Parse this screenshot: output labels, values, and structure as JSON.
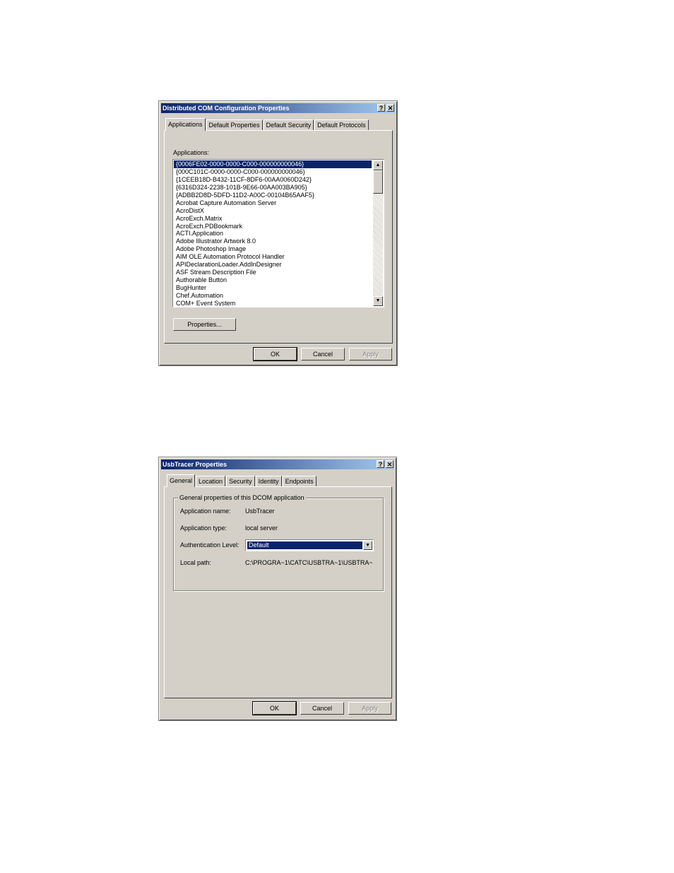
{
  "dialog1": {
    "title": "Distributed COM Configuration Properties",
    "help_btn": "?",
    "close_btn": "✕",
    "tabs": [
      "Applications",
      "Default Properties",
      "Default Security",
      "Default Protocols"
    ],
    "applications_label": "Applications:",
    "applications": [
      "{0006FE02-0000-0000-C000-000000000046}",
      "{000C101C-0000-0000-C000-000000000046}",
      "{1CEEB18D-B432-11CF-8DF6-00AA0060D242}",
      "{6316D324-2238-101B-9E66-00AA003BA905}",
      "{ADBB2D8D-5DFD-11D2-A00C-00104B65AAF5}",
      "Acrobat Capture Automation Server",
      "AcroDistX",
      "AcroExch.Matrix",
      "AcroExch.PDBookmark",
      "ACTI.Application",
      "Adobe Illustrator Artwork 8.0",
      "Adobe Photoshop Image",
      "AIM OLE Automation Protocol Handler",
      "APIDeclarationLoader.AddInDesigner",
      "ASF Stream Description File",
      "Authorable Button",
      "BugHunter",
      "Chef.Automation",
      "COM+ Event System"
    ],
    "selected_index": 0,
    "scroll_up": "▲",
    "scroll_down": "▼",
    "properties_btn": "Properties...",
    "ok_btn": "OK",
    "cancel_btn": "Cancel",
    "apply_btn": "Apply"
  },
  "dialog2": {
    "title": "UsbTracer Properties",
    "help_btn": "?",
    "close_btn": "✕",
    "tabs": [
      "General",
      "Location",
      "Security",
      "Identity",
      "Endpoints"
    ],
    "group_label": "General properties of this DCOM application",
    "app_name_label": "Application name:",
    "app_name_value": "UsbTracer",
    "app_type_label": "Application type:",
    "app_type_value": "local server",
    "auth_level_label": "Authentication Level:",
    "auth_level_value": "Default",
    "combo_arrow": "▼",
    "local_path_label": "Local path:",
    "local_path_value": "C:\\PROGRA~1\\CATC\\USBTRA~1\\USBTRA~",
    "ok_btn": "OK",
    "cancel_btn": "Cancel",
    "apply_btn": "Apply"
  }
}
